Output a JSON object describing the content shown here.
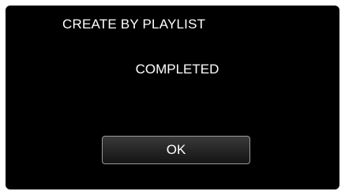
{
  "dialog": {
    "title": "CREATE BY PLAYLIST",
    "message": "COMPLETED",
    "ok_label": "OK"
  }
}
